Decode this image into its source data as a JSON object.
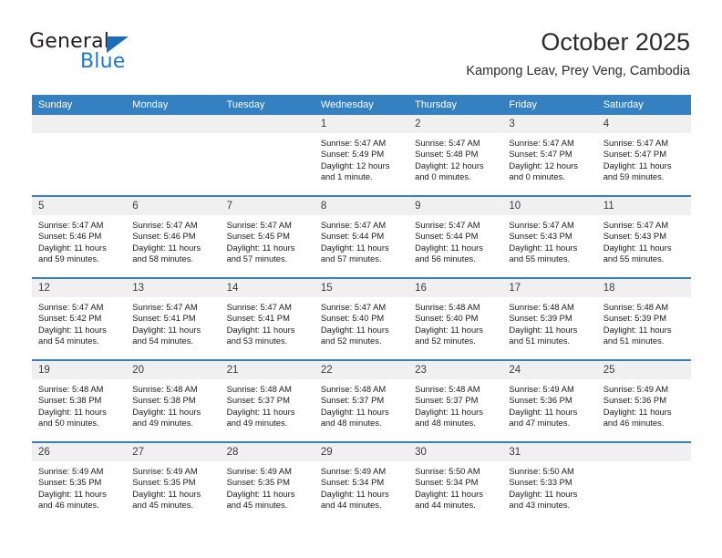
{
  "brand": {
    "name_part1": "General",
    "name_part2": "Blue",
    "triangle_color": "#1f6cb4",
    "blue_text_color": "#1e7ac4"
  },
  "header": {
    "title": "October 2025",
    "subtitle": "Kampong Leav, Prey Veng, Cambodia"
  },
  "theme": {
    "header_blue": "#3580c0",
    "daynum_band": "#f0f0f0",
    "text": "#1b1b1b"
  },
  "calendar": {
    "weekday_headers": [
      "Sunday",
      "Monday",
      "Tuesday",
      "Wednesday",
      "Thursday",
      "Friday",
      "Saturday"
    ],
    "weeks": [
      [
        {
          "day": "",
          "blank": true,
          "sunrise": "",
          "sunset": "",
          "daylight1": "",
          "daylight2": ""
        },
        {
          "day": "",
          "blank": true,
          "sunrise": "",
          "sunset": "",
          "daylight1": "",
          "daylight2": ""
        },
        {
          "day": "",
          "blank": true,
          "sunrise": "",
          "sunset": "",
          "daylight1": "",
          "daylight2": ""
        },
        {
          "day": "1",
          "blank": false,
          "sunrise": "Sunrise: 5:47 AM",
          "sunset": "Sunset: 5:49 PM",
          "daylight1": "Daylight: 12 hours",
          "daylight2": "and 1 minute."
        },
        {
          "day": "2",
          "blank": false,
          "sunrise": "Sunrise: 5:47 AM",
          "sunset": "Sunset: 5:48 PM",
          "daylight1": "Daylight: 12 hours",
          "daylight2": "and 0 minutes."
        },
        {
          "day": "3",
          "blank": false,
          "sunrise": "Sunrise: 5:47 AM",
          "sunset": "Sunset: 5:47 PM",
          "daylight1": "Daylight: 12 hours",
          "daylight2": "and 0 minutes."
        },
        {
          "day": "4",
          "blank": false,
          "sunrise": "Sunrise: 5:47 AM",
          "sunset": "Sunset: 5:47 PM",
          "daylight1": "Daylight: 11 hours",
          "daylight2": "and 59 minutes."
        }
      ],
      [
        {
          "day": "5",
          "blank": false,
          "sunrise": "Sunrise: 5:47 AM",
          "sunset": "Sunset: 5:46 PM",
          "daylight1": "Daylight: 11 hours",
          "daylight2": "and 59 minutes."
        },
        {
          "day": "6",
          "blank": false,
          "sunrise": "Sunrise: 5:47 AM",
          "sunset": "Sunset: 5:46 PM",
          "daylight1": "Daylight: 11 hours",
          "daylight2": "and 58 minutes."
        },
        {
          "day": "7",
          "blank": false,
          "sunrise": "Sunrise: 5:47 AM",
          "sunset": "Sunset: 5:45 PM",
          "daylight1": "Daylight: 11 hours",
          "daylight2": "and 57 minutes."
        },
        {
          "day": "8",
          "blank": false,
          "sunrise": "Sunrise: 5:47 AM",
          "sunset": "Sunset: 5:44 PM",
          "daylight1": "Daylight: 11 hours",
          "daylight2": "and 57 minutes."
        },
        {
          "day": "9",
          "blank": false,
          "sunrise": "Sunrise: 5:47 AM",
          "sunset": "Sunset: 5:44 PM",
          "daylight1": "Daylight: 11 hours",
          "daylight2": "and 56 minutes."
        },
        {
          "day": "10",
          "blank": false,
          "sunrise": "Sunrise: 5:47 AM",
          "sunset": "Sunset: 5:43 PM",
          "daylight1": "Daylight: 11 hours",
          "daylight2": "and 55 minutes."
        },
        {
          "day": "11",
          "blank": false,
          "sunrise": "Sunrise: 5:47 AM",
          "sunset": "Sunset: 5:43 PM",
          "daylight1": "Daylight: 11 hours",
          "daylight2": "and 55 minutes."
        }
      ],
      [
        {
          "day": "12",
          "blank": false,
          "sunrise": "Sunrise: 5:47 AM",
          "sunset": "Sunset: 5:42 PM",
          "daylight1": "Daylight: 11 hours",
          "daylight2": "and 54 minutes."
        },
        {
          "day": "13",
          "blank": false,
          "sunrise": "Sunrise: 5:47 AM",
          "sunset": "Sunset: 5:41 PM",
          "daylight1": "Daylight: 11 hours",
          "daylight2": "and 54 minutes."
        },
        {
          "day": "14",
          "blank": false,
          "sunrise": "Sunrise: 5:47 AM",
          "sunset": "Sunset: 5:41 PM",
          "daylight1": "Daylight: 11 hours",
          "daylight2": "and 53 minutes."
        },
        {
          "day": "15",
          "blank": false,
          "sunrise": "Sunrise: 5:47 AM",
          "sunset": "Sunset: 5:40 PM",
          "daylight1": "Daylight: 11 hours",
          "daylight2": "and 52 minutes."
        },
        {
          "day": "16",
          "blank": false,
          "sunrise": "Sunrise: 5:48 AM",
          "sunset": "Sunset: 5:40 PM",
          "daylight1": "Daylight: 11 hours",
          "daylight2": "and 52 minutes."
        },
        {
          "day": "17",
          "blank": false,
          "sunrise": "Sunrise: 5:48 AM",
          "sunset": "Sunset: 5:39 PM",
          "daylight1": "Daylight: 11 hours",
          "daylight2": "and 51 minutes."
        },
        {
          "day": "18",
          "blank": false,
          "sunrise": "Sunrise: 5:48 AM",
          "sunset": "Sunset: 5:39 PM",
          "daylight1": "Daylight: 11 hours",
          "daylight2": "and 51 minutes."
        }
      ],
      [
        {
          "day": "19",
          "blank": false,
          "sunrise": "Sunrise: 5:48 AM",
          "sunset": "Sunset: 5:38 PM",
          "daylight1": "Daylight: 11 hours",
          "daylight2": "and 50 minutes."
        },
        {
          "day": "20",
          "blank": false,
          "sunrise": "Sunrise: 5:48 AM",
          "sunset": "Sunset: 5:38 PM",
          "daylight1": "Daylight: 11 hours",
          "daylight2": "and 49 minutes."
        },
        {
          "day": "21",
          "blank": false,
          "sunrise": "Sunrise: 5:48 AM",
          "sunset": "Sunset: 5:37 PM",
          "daylight1": "Daylight: 11 hours",
          "daylight2": "and 49 minutes."
        },
        {
          "day": "22",
          "blank": false,
          "sunrise": "Sunrise: 5:48 AM",
          "sunset": "Sunset: 5:37 PM",
          "daylight1": "Daylight: 11 hours",
          "daylight2": "and 48 minutes."
        },
        {
          "day": "23",
          "blank": false,
          "sunrise": "Sunrise: 5:48 AM",
          "sunset": "Sunset: 5:37 PM",
          "daylight1": "Daylight: 11 hours",
          "daylight2": "and 48 minutes."
        },
        {
          "day": "24",
          "blank": false,
          "sunrise": "Sunrise: 5:49 AM",
          "sunset": "Sunset: 5:36 PM",
          "daylight1": "Daylight: 11 hours",
          "daylight2": "and 47 minutes."
        },
        {
          "day": "25",
          "blank": false,
          "sunrise": "Sunrise: 5:49 AM",
          "sunset": "Sunset: 5:36 PM",
          "daylight1": "Daylight: 11 hours",
          "daylight2": "and 46 minutes."
        }
      ],
      [
        {
          "day": "26",
          "blank": false,
          "sunrise": "Sunrise: 5:49 AM",
          "sunset": "Sunset: 5:35 PM",
          "daylight1": "Daylight: 11 hours",
          "daylight2": "and 46 minutes."
        },
        {
          "day": "27",
          "blank": false,
          "sunrise": "Sunrise: 5:49 AM",
          "sunset": "Sunset: 5:35 PM",
          "daylight1": "Daylight: 11 hours",
          "daylight2": "and 45 minutes."
        },
        {
          "day": "28",
          "blank": false,
          "sunrise": "Sunrise: 5:49 AM",
          "sunset": "Sunset: 5:35 PM",
          "daylight1": "Daylight: 11 hours",
          "daylight2": "and 45 minutes."
        },
        {
          "day": "29",
          "blank": false,
          "sunrise": "Sunrise: 5:49 AM",
          "sunset": "Sunset: 5:34 PM",
          "daylight1": "Daylight: 11 hours",
          "daylight2": "and 44 minutes."
        },
        {
          "day": "30",
          "blank": false,
          "sunrise": "Sunrise: 5:50 AM",
          "sunset": "Sunset: 5:34 PM",
          "daylight1": "Daylight: 11 hours",
          "daylight2": "and 44 minutes."
        },
        {
          "day": "31",
          "blank": false,
          "sunrise": "Sunrise: 5:50 AM",
          "sunset": "Sunset: 5:33 PM",
          "daylight1": "Daylight: 11 hours",
          "daylight2": "and 43 minutes."
        },
        {
          "day": "",
          "blank": true,
          "sunrise": "",
          "sunset": "",
          "daylight1": "",
          "daylight2": ""
        }
      ]
    ]
  }
}
